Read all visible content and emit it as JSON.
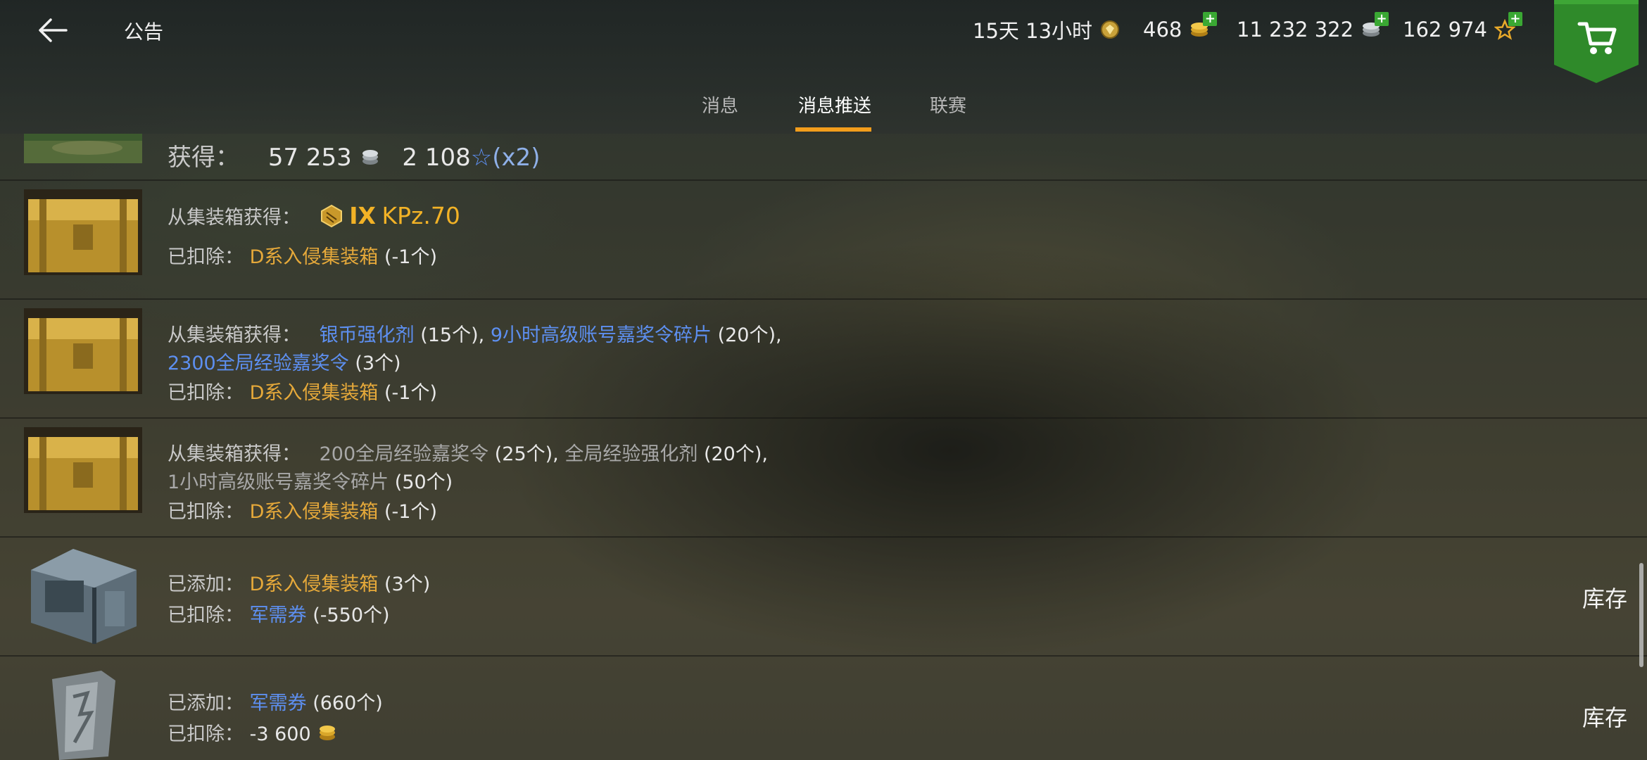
{
  "header": {
    "title": "公告",
    "premium_time": "15天 13小时",
    "gold": "468",
    "silver": "11 232 322",
    "free_xp": "162 974"
  },
  "tabs": [
    {
      "label": "消息"
    },
    {
      "label": "消息推送"
    },
    {
      "label": "联赛"
    }
  ],
  "rows": [
    {
      "label": "获得：",
      "silver": "57 253",
      "xp": "2 108",
      "mult": "(x2)"
    },
    {
      "get_label": "从集装箱获得：",
      "tier": "IX",
      "tank": "KPz.70",
      "deduct_label": "已扣除：",
      "deduct_item": "D系入侵集装箱",
      "deduct_qty": "(-1个)"
    },
    {
      "get_label": "从集装箱获得：",
      "item1": "银币强化剂",
      "qty1": "(15个)",
      "sep1": ",",
      "item2": "9小时高级账号嘉奖令碎片",
      "qty2": "(20个)",
      "sep2": ",",
      "item3": "2300全局经验嘉奖令",
      "qty3": "(3个)",
      "deduct_label": "已扣除：",
      "deduct_item": "D系入侵集装箱",
      "deduct_qty": "(-1个)"
    },
    {
      "get_label": "从集装箱获得：",
      "item1": "200全局经验嘉奖令",
      "qty1": "(25个)",
      "sep1": ",",
      "item2": "全局经验强化剂",
      "qty2": "(20个)",
      "sep2": ",",
      "item3": "1小时高级账号嘉奖令碎片",
      "qty3": "(50个)",
      "deduct_label": "已扣除：",
      "deduct_item": "D系入侵集装箱",
      "deduct_qty": "(-1个)"
    },
    {
      "add_label": "已添加：",
      "add_item": "D系入侵集装箱",
      "add_qty": "(3个)",
      "deduct_label": "已扣除：",
      "deduct_item": "军需券",
      "deduct_qty": "(-550个)",
      "button": "库存"
    },
    {
      "add_label": "已添加：",
      "add_item": "军需券",
      "add_qty": "(660个)",
      "deduct_label": "已扣除：",
      "deduct_value": "-3 600",
      "button": "库存"
    }
  ],
  "colors": {
    "accent": "#f29d1c",
    "item_gold": "#e6a93a",
    "item_blue": "#5d8ff0",
    "buy_green": "#2f8a2a"
  },
  "icons": [
    "back-arrow-icon",
    "premium-badge-icon",
    "gold-coin-icon",
    "silver-coin-icon",
    "free-xp-star-icon",
    "shopping-cart-icon",
    "container-icon",
    "ticket-icon",
    "tier-emblem-icon"
  ]
}
